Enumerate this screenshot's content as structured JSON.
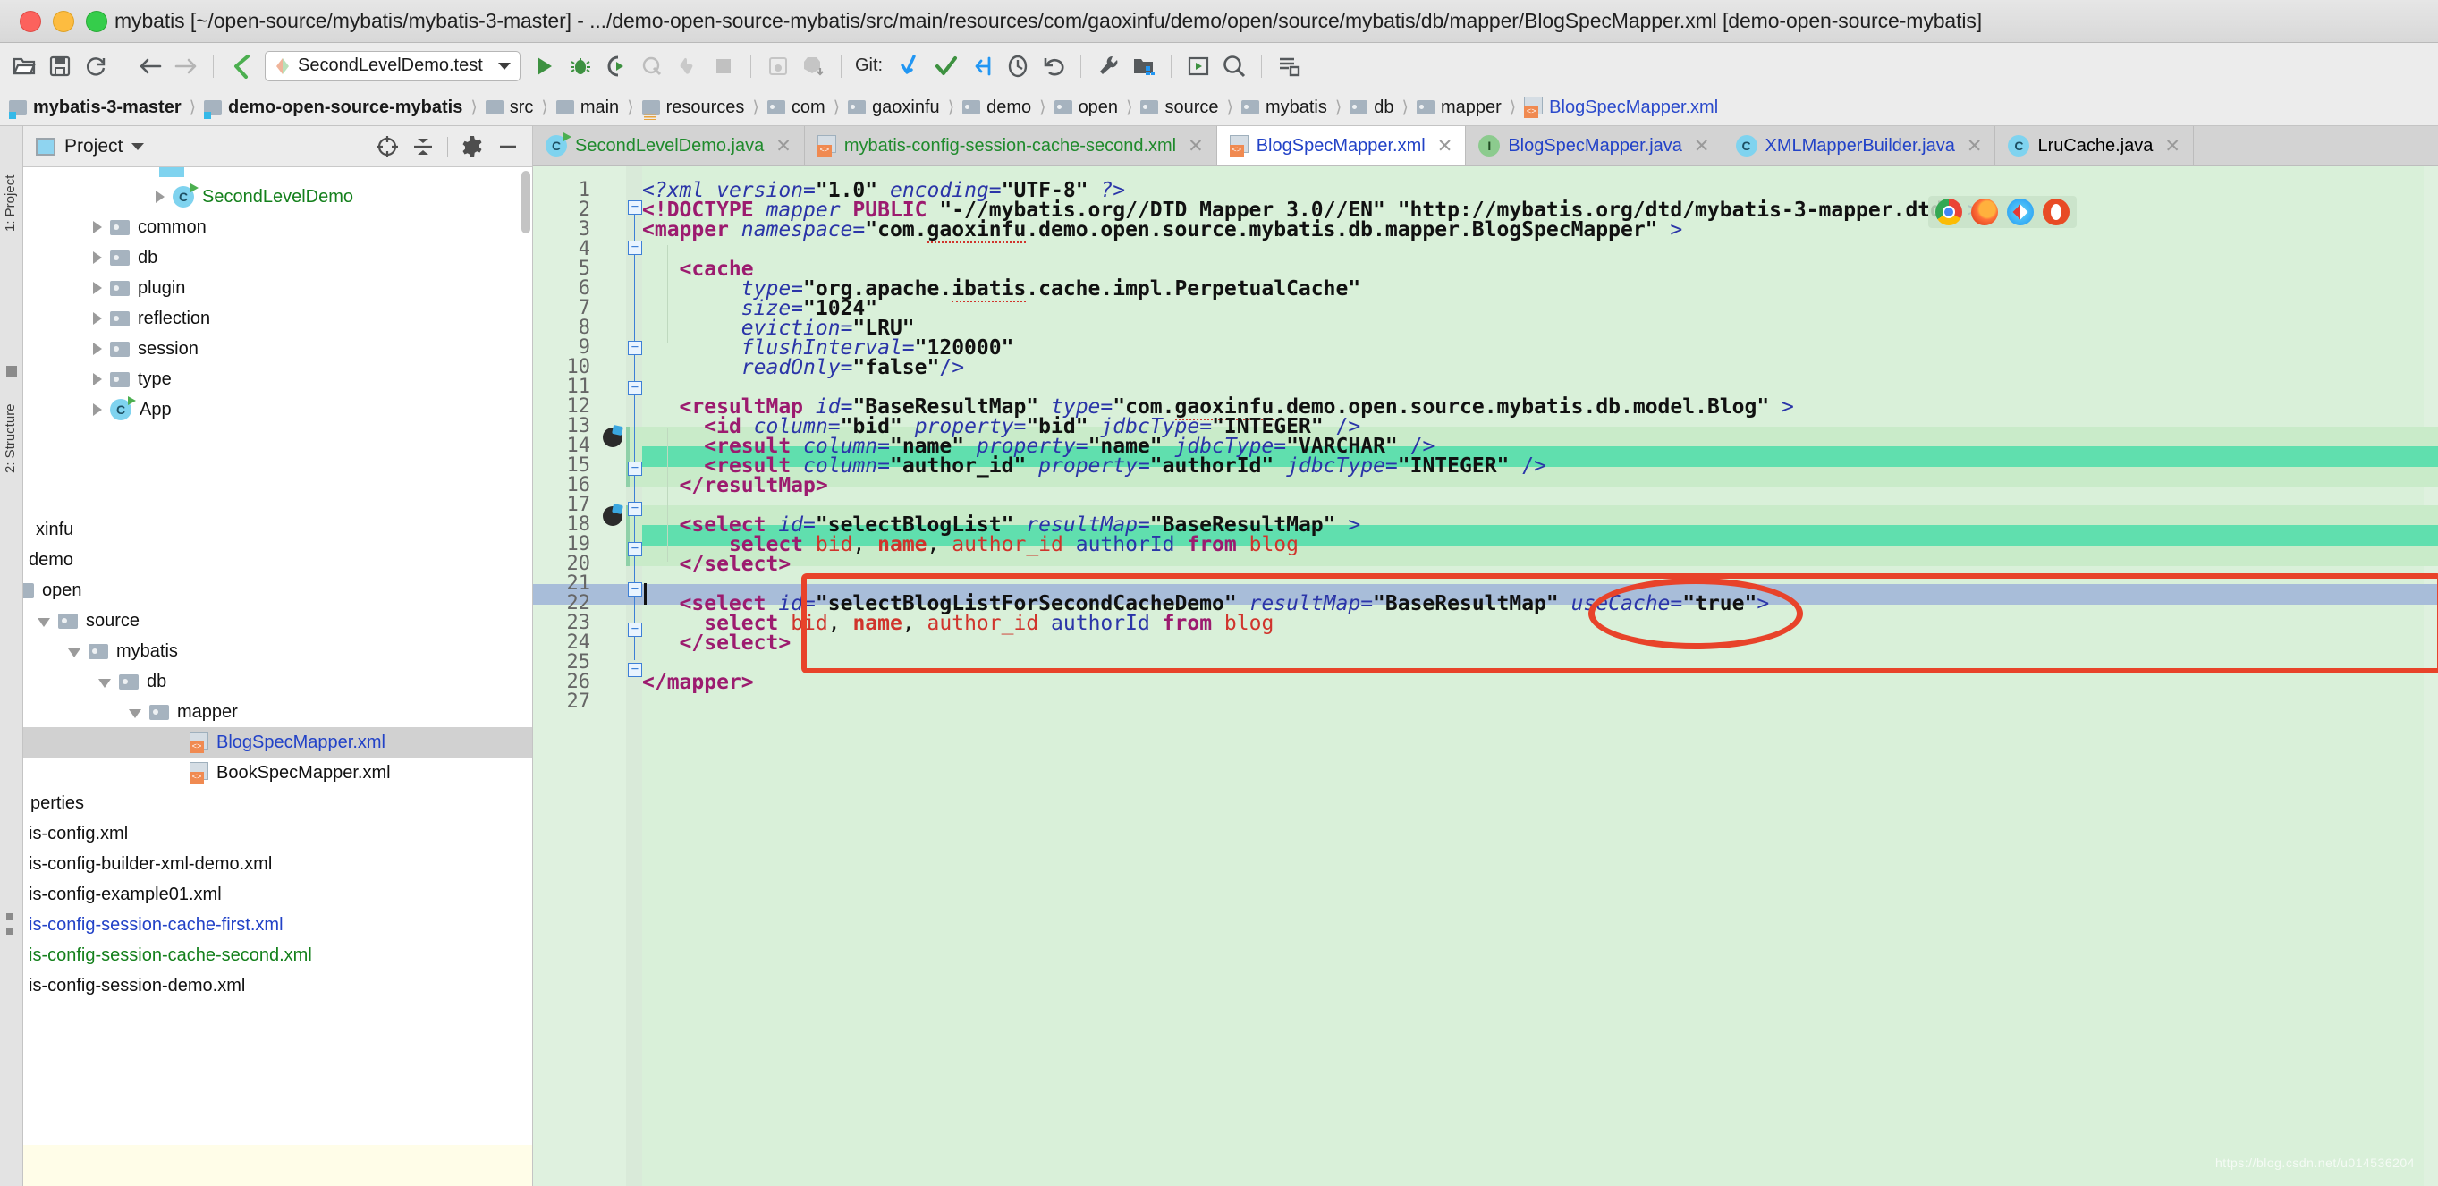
{
  "window": {
    "title": "mybatis [~/open-source/mybatis/mybatis-3-master] - .../demo-open-source-mybatis/src/main/resources/com/gaoxinfu/demo/open/source/mybatis/db/mapper/BlogSpecMapper.xml [demo-open-source-mybatis]",
    "traffic": {
      "close": "close-button",
      "minimize": "minimize-button",
      "zoom": "zoom-button"
    }
  },
  "toolbar": {
    "run_config": "SecondLevelDemo.test",
    "git_label": "Git:",
    "icons": [
      "open-folder-icon",
      "save-icon",
      "sync-icon",
      "back-arrow-icon",
      "forward-arrow-icon",
      "last-edit-location-icon",
      "run-icon",
      "debug-icon",
      "run-with-coverage-icon",
      "profile-icon",
      "stop-icon-disabled",
      "rerun-icon",
      "build-icon",
      "build-module-icon",
      "update-project-icon",
      "commit-icon",
      "push-icon",
      "history-icon",
      "rollback-icon",
      "settings-wrench-icon",
      "project-structure-icon",
      "run-anything-icon",
      "search-everywhere-icon",
      "layout-icon"
    ]
  },
  "breadcrumb": [
    {
      "label": "mybatis-3-master",
      "icon": "module-icon",
      "bold": true
    },
    {
      "label": "demo-open-source-mybatis",
      "icon": "module-icon",
      "bold": true
    },
    {
      "label": "src",
      "icon": "folder-icon",
      "bold": false
    },
    {
      "label": "main",
      "icon": "folder-icon",
      "bold": false
    },
    {
      "label": "resources",
      "icon": "resources-folder-icon",
      "bold": false
    },
    {
      "label": "com",
      "icon": "package-icon",
      "bold": false
    },
    {
      "label": "gaoxinfu",
      "icon": "package-icon",
      "bold": false
    },
    {
      "label": "demo",
      "icon": "package-icon",
      "bold": false
    },
    {
      "label": "open",
      "icon": "package-icon",
      "bold": false
    },
    {
      "label": "source",
      "icon": "package-icon",
      "bold": false
    },
    {
      "label": "mybatis",
      "icon": "package-icon",
      "bold": false
    },
    {
      "label": "db",
      "icon": "package-icon",
      "bold": false
    },
    {
      "label": "mapper",
      "icon": "package-icon",
      "bold": false
    },
    {
      "label": "BlogSpecMapper.xml",
      "icon": "xml-file-icon",
      "bold": false,
      "file": true
    }
  ],
  "project_panel": {
    "title": "Project",
    "rail_labels": [
      "1: Project",
      "2: Structure"
    ],
    "actions": [
      "locate-icon",
      "collapse-all-icon",
      "settings-gear-icon",
      "hide-icon"
    ],
    "tree": [
      {
        "label": "SecondLevelDemo",
        "icon": "class-icon-runnable",
        "indent": 5,
        "arrow": "closed",
        "color": "green"
      },
      {
        "label": "common",
        "icon": "folder-icon",
        "indent": 2,
        "arrow": "closed",
        "color": "default"
      },
      {
        "label": "db",
        "icon": "folder-icon",
        "indent": 2,
        "arrow": "closed",
        "color": "default"
      },
      {
        "label": "plugin",
        "icon": "folder-icon",
        "indent": 2,
        "arrow": "closed",
        "color": "default"
      },
      {
        "label": "reflection",
        "icon": "folder-icon",
        "indent": 2,
        "arrow": "closed",
        "color": "default"
      },
      {
        "label": "session",
        "icon": "folder-icon",
        "indent": 2,
        "arrow": "closed",
        "color": "default"
      },
      {
        "label": "type",
        "icon": "folder-icon",
        "indent": 2,
        "arrow": "closed",
        "color": "default"
      },
      {
        "label": "App",
        "icon": "class-icon-runnable",
        "indent": 2,
        "arrow": "closed",
        "color": "default"
      },
      {
        "label": "xinfu",
        "icon": "none",
        "indent": 0,
        "arrow": "none",
        "color": "default",
        "clipped": true
      },
      {
        "label": "demo",
        "icon": "none",
        "indent": 0,
        "arrow": "none",
        "color": "default",
        "clipped": true
      },
      {
        "label": "open",
        "icon": "package-icon",
        "indent": 0,
        "arrow": "none",
        "color": "default",
        "clipped": true
      },
      {
        "label": "source",
        "icon": "package-icon",
        "indent": 1,
        "arrow": "open",
        "color": "default"
      },
      {
        "label": "mybatis",
        "icon": "package-icon",
        "indent": 2,
        "arrow": "open",
        "color": "default"
      },
      {
        "label": "db",
        "icon": "package-icon",
        "indent": 3,
        "arrow": "open",
        "color": "default"
      },
      {
        "label": "mapper",
        "icon": "package-icon",
        "indent": 4,
        "arrow": "open",
        "color": "default"
      },
      {
        "label": "BlogSpecMapper.xml",
        "icon": "xml-file-icon",
        "indent": 5,
        "arrow": "none",
        "color": "blue",
        "selected": true
      },
      {
        "label": "BookSpecMapper.xml",
        "icon": "xml-file-icon",
        "indent": 5,
        "arrow": "none",
        "color": "default"
      },
      {
        "label": "perties",
        "icon": "none",
        "indent": 0,
        "arrow": "none",
        "color": "default",
        "clipped": true
      },
      {
        "label": "is-config.xml",
        "icon": "none",
        "indent": 0,
        "arrow": "none",
        "color": "default",
        "clipped": true
      },
      {
        "label": "is-config-builder-xml-demo.xml",
        "icon": "none",
        "indent": 0,
        "arrow": "none",
        "color": "default",
        "clipped": true
      },
      {
        "label": "is-config-example01.xml",
        "icon": "none",
        "indent": 0,
        "arrow": "none",
        "color": "default",
        "clipped": true
      },
      {
        "label": "is-config-session-cache-first.xml",
        "icon": "none",
        "indent": 0,
        "arrow": "none",
        "color": "blue",
        "clipped": true
      },
      {
        "label": "is-config-session-cache-second.xml",
        "icon": "none",
        "indent": 0,
        "arrow": "none",
        "color": "green",
        "clipped": true
      },
      {
        "label": "is-config-session-demo.xml",
        "icon": "none",
        "indent": 0,
        "arrow": "none",
        "color": "default",
        "clipped": true
      }
    ]
  },
  "tabs": [
    {
      "label": "SecondLevelDemo.java",
      "icon": "java-class-icon",
      "color": "green",
      "active": false,
      "closable": true
    },
    {
      "label": "mybatis-config-session-cache-second.xml",
      "icon": "xml-file-icon",
      "color": "green",
      "active": false,
      "closable": true
    },
    {
      "label": "BlogSpecMapper.xml",
      "icon": "xml-file-icon",
      "color": "blue",
      "active": true,
      "closable": true
    },
    {
      "label": "BlogSpecMapper.java",
      "icon": "java-interface-icon",
      "color": "blue",
      "active": false,
      "closable": true
    },
    {
      "label": "XMLMapperBuilder.java",
      "icon": "java-class-icon",
      "color": "blue",
      "active": false,
      "closable": true
    },
    {
      "label": "LruCache.java",
      "icon": "java-class-icon",
      "color": "default",
      "active": false,
      "closable": true
    }
  ],
  "editor": {
    "filename": "BlogSpecMapper.xml",
    "language": "XML",
    "line_count": 27,
    "caret_line": 27,
    "line_numbers": [
      1,
      2,
      3,
      4,
      5,
      6,
      7,
      8,
      9,
      10,
      11,
      12,
      13,
      14,
      15,
      16,
      17,
      18,
      19,
      20,
      21,
      22,
      23,
      24,
      25,
      26,
      27
    ],
    "lines": [
      "<?xml version=\"1.0\" encoding=\"UTF-8\" ?>",
      "<!DOCTYPE mapper PUBLIC \"-//mybatis.org//DTD Mapper 3.0//EN\" \"http://mybatis.org/dtd/mybatis-3-mapper.dtd\" >",
      "<mapper namespace=\"com.gaoxinfu.demo.open.source.mybatis.db.mapper.BlogSpecMapper\" >",
      "",
      "    <cache",
      "         type=\"org.apache.ibatis.cache.impl.PerpetualCache\"",
      "         size=\"1024\"",
      "         eviction=\"LRU\"",
      "         flushInterval=\"120000\"",
      "         readOnly=\"false\"/>",
      "",
      "    <resultMap id=\"BaseResultMap\" type=\"com.gaoxinfu.demo.open.source.mybatis.db.model.Blog\" >",
      "      <id column=\"bid\" property=\"bid\" jdbcType=\"INTEGER\" />",
      "      <result column=\"name\" property=\"name\" jdbcType=\"VARCHAR\" />",
      "      <result column=\"author_id\" property=\"authorId\" jdbcType=\"INTEGER\" />",
      "    </resultMap>",
      "",
      "    <select id=\"selectBlogList\" resultMap=\"BaseResultMap\" >",
      "        select bid, name, author_id authorId from blog",
      "    </select>",
      "",
      "    <select id=\"selectBlogListForSecondCacheDemo\" resultMap=\"BaseResultMap\" useCache=\"true\">",
      "      select bid, name, author_id authorId from blog",
      "    </select>",
      "",
      "</mapper>",
      ""
    ],
    "breakpoint_lines": [
      18,
      22
    ],
    "highlighted_sql_lines": [
      19,
      23
    ],
    "annotations": {
      "ellipse_target": "useCache=\"true\"",
      "rect_target_lines": [
        22,
        23,
        24,
        25
      ],
      "color": "#e8432a"
    },
    "browser_overlay_icons": [
      "chrome-icon",
      "firefox-icon",
      "safari-icon",
      "opera-icon"
    ],
    "watermark": "https://blog.csdn.net/u014536204"
  }
}
